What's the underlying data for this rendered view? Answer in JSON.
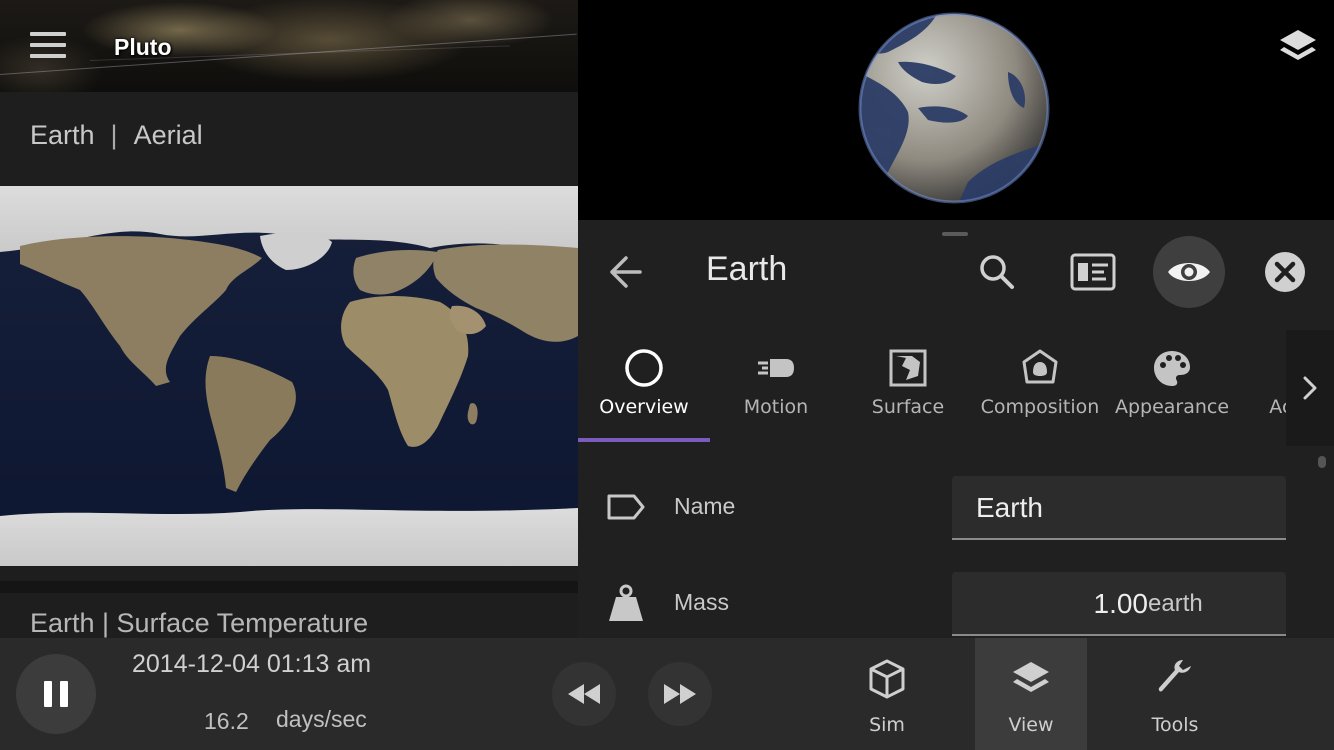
{
  "top_bar": {
    "target_label": "Pluto"
  },
  "left_panel": {
    "body_name": "Earth",
    "separator": "|",
    "view_name": "Aerial",
    "next_header": "Earth | Surface Temperature"
  },
  "info_panel": {
    "title": "Earth",
    "tabs": [
      {
        "label": "Overview",
        "icon": "circle-icon",
        "active": true
      },
      {
        "label": "Motion",
        "icon": "motion-icon"
      },
      {
        "label": "Surface",
        "icon": "surface-icon"
      },
      {
        "label": "Composition",
        "icon": "composition-icon"
      },
      {
        "label": "Appearance",
        "icon": "palette-icon"
      },
      {
        "label": "Actions",
        "icon": "actions-icon"
      }
    ],
    "fields": {
      "name": {
        "label": "Name",
        "value": "Earth"
      },
      "mass": {
        "label": "Mass",
        "value": "1.00",
        "unit": "earth"
      }
    }
  },
  "bottom_bar": {
    "datetime": "2014-12-04 01:13 am",
    "rate_value": "16.2",
    "rate_unit": "days/sec",
    "nav": [
      {
        "label": "Sim",
        "icon": "cube-icon"
      },
      {
        "label": "View",
        "icon": "layers-icon",
        "active": true
      },
      {
        "label": "Tools",
        "icon": "wrench-icon"
      }
    ]
  },
  "colors": {
    "accent": "#7c5bbf",
    "panel_bg": "#202020",
    "bottom_bar_bg": "#2a2a2a"
  }
}
